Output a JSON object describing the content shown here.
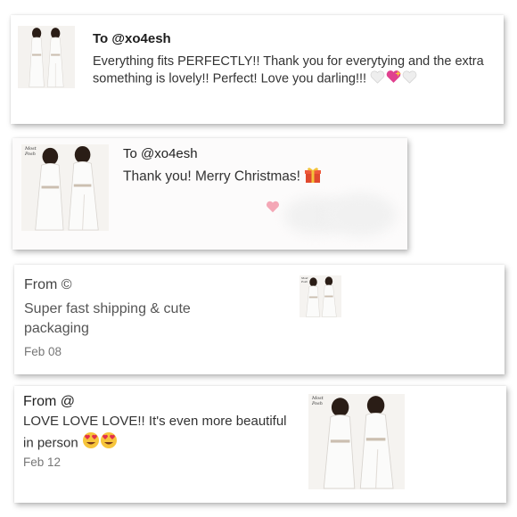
{
  "reviews": [
    {
      "recipient": "To @xo4esh",
      "message": "Everything fits PERFECTLY!! Thank you for everytying and the extra something is lovely!! Perfect! Love you darling!!!",
      "emojis": [
        "white-heart",
        "sparkling-heart",
        "white-heart"
      ]
    },
    {
      "recipient": "To @xo4esh",
      "message": "Thank you! Merry Christmas!",
      "emojis": [
        "gift"
      ],
      "thumb_caption": "Most Posh"
    },
    {
      "sender": "From ©",
      "message": "Super fast shipping & cute packaging",
      "date": "Feb 08",
      "thumb_caption": "Most Posh"
    },
    {
      "sender": "From @",
      "message": "LOVE LOVE LOVE!! It's even more beautiful in person",
      "emojis": [
        "heart-eyes",
        "heart-eyes"
      ],
      "date": "Feb 12",
      "thumb_caption": "Most Posh"
    }
  ]
}
